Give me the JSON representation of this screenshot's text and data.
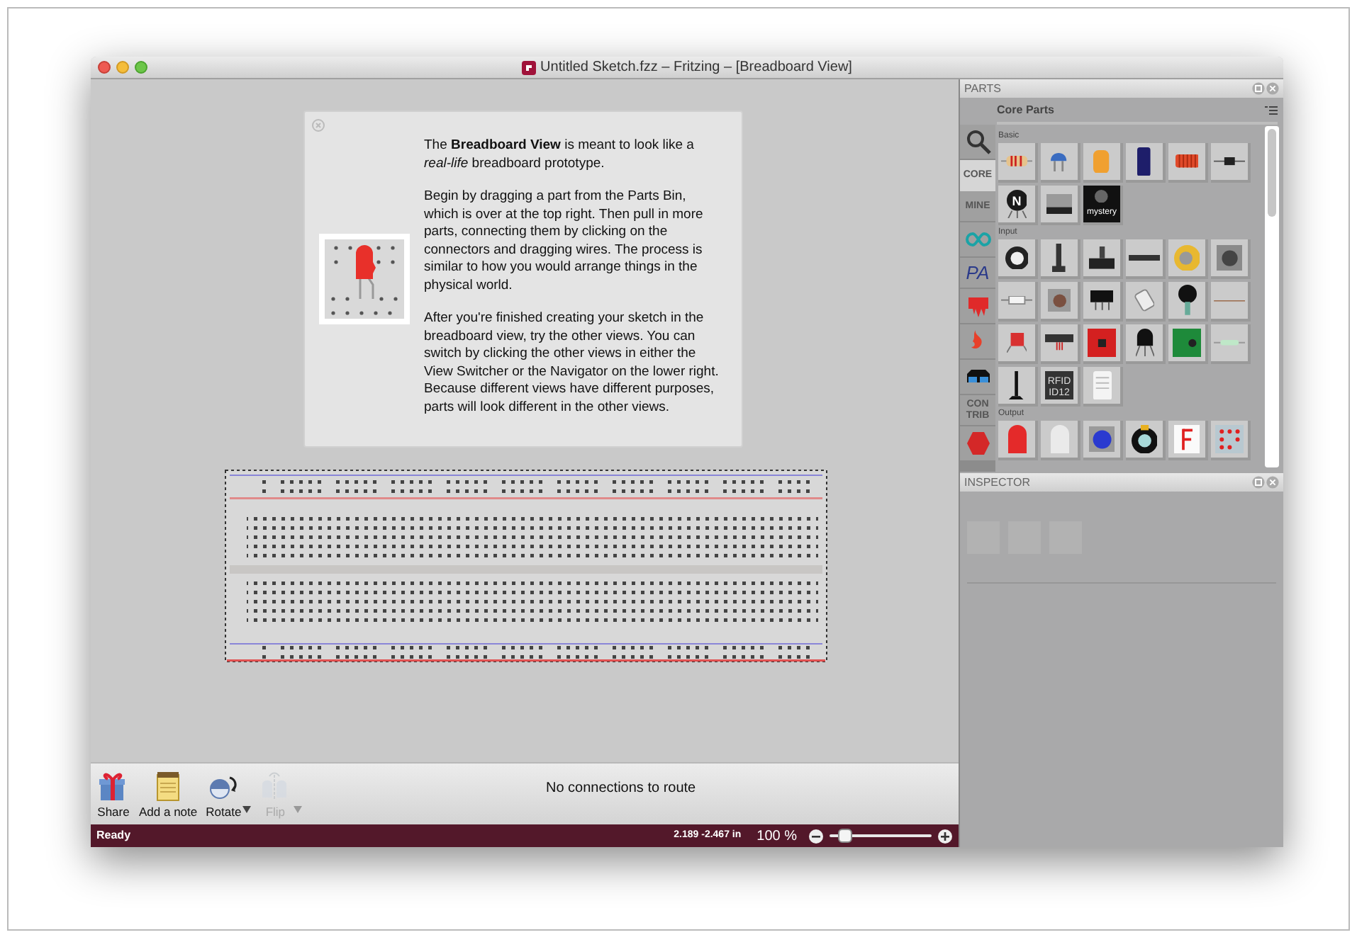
{
  "window": {
    "title": "Untitled Sketch.fzz – Fritzing – [Breadboard View]"
  },
  "welcome": {
    "paragraphs": [
      "The **Breadboard View** is meant to look like a *real-life* breadboard prototype.",
      "Begin by dragging a part from the Parts Bin, which is over at the top right. Then pull in more parts, connecting them by clicking on the connectors and dragging wires. The process is similar to how you would arrange things in the physical world.",
      "After you're finished creating your sketch in the breadboard view, try the other views. You can switch by clicking the other views in either the View Switcher or the Navigator on the lower right. Because different views have different purposes, parts will look different in the other views."
    ]
  },
  "toolbar": {
    "buttons": [
      {
        "kind": "share",
        "label": "Share",
        "disabled": false,
        "menu": false
      },
      {
        "kind": "note",
        "label": "Add a note",
        "disabled": false,
        "menu": false
      },
      {
        "kind": "rotate",
        "label": "Rotate",
        "disabled": false,
        "menu": true
      },
      {
        "kind": "flip",
        "label": "Flip",
        "disabled": true,
        "menu": true
      }
    ],
    "message": "No connections to route"
  },
  "status_bar": {
    "text": "Ready",
    "coordinates": "2.189 -2.467 in",
    "zoom": "100 %",
    "zoom_slider": {
      "level": 0.12
    }
  },
  "parts": {
    "title": "PARTS",
    "bin_title": "Core Parts",
    "tabs": [
      {
        "kind": "search",
        "selected": false
      },
      {
        "kind": "text",
        "label": "CORE",
        "selected": true
      },
      {
        "kind": "text",
        "label": "MINE",
        "selected": false
      },
      {
        "kind": "arduino",
        "selected": false
      },
      {
        "kind": "logo",
        "label": "PA",
        "selected": false
      },
      {
        "kind": "flame",
        "selected": false
      },
      {
        "kind": "sparkfun",
        "selected": false
      },
      {
        "kind": "glasses",
        "selected": false
      },
      {
        "kind": "text",
        "label": "CON TRIB",
        "selected": false
      },
      {
        "kind": "hexagon",
        "selected": false
      }
    ],
    "sections": [
      {
        "label": "Basic",
        "items": [
          {
            "kind": "resistor"
          },
          {
            "kind": "ceramic-capacitor"
          },
          {
            "kind": "tantalum-capacitor"
          },
          {
            "kind": "electrolytic-capacitor"
          },
          {
            "kind": "inductor"
          },
          {
            "kind": "diode"
          },
          {
            "kind": "transistor",
            "text": "N"
          },
          {
            "kind": "battery"
          },
          {
            "kind": "mystery",
            "text": "mystery"
          }
        ]
      },
      {
        "label": "Input",
        "items": [
          {
            "kind": "potentiometer"
          },
          {
            "kind": "slide-pot"
          },
          {
            "kind": "rotary"
          },
          {
            "kind": "strip"
          },
          {
            "kind": "knob"
          },
          {
            "kind": "rotary-switch"
          },
          {
            "kind": "fuse"
          },
          {
            "kind": "pushbutton"
          },
          {
            "kind": "switch"
          },
          {
            "kind": "tilt"
          },
          {
            "kind": "fsr"
          },
          {
            "kind": "flex"
          },
          {
            "kind": "photocell"
          },
          {
            "kind": "distance"
          },
          {
            "kind": "red-board"
          },
          {
            "kind": "temp-sensor"
          },
          {
            "kind": "green-board"
          },
          {
            "kind": "reed"
          },
          {
            "kind": "microphone"
          },
          {
            "kind": "rfid",
            "text": "RFID ID12"
          },
          {
            "kind": "humidity"
          }
        ]
      },
      {
        "label": "Output",
        "items": [
          {
            "kind": "led-red"
          },
          {
            "kind": "led-white"
          },
          {
            "kind": "led-blue"
          },
          {
            "kind": "rgb-led"
          },
          {
            "kind": "seven-segment"
          },
          {
            "kind": "led-matrix"
          }
        ]
      }
    ]
  },
  "inspector": {
    "title": "INSPECTOR"
  }
}
